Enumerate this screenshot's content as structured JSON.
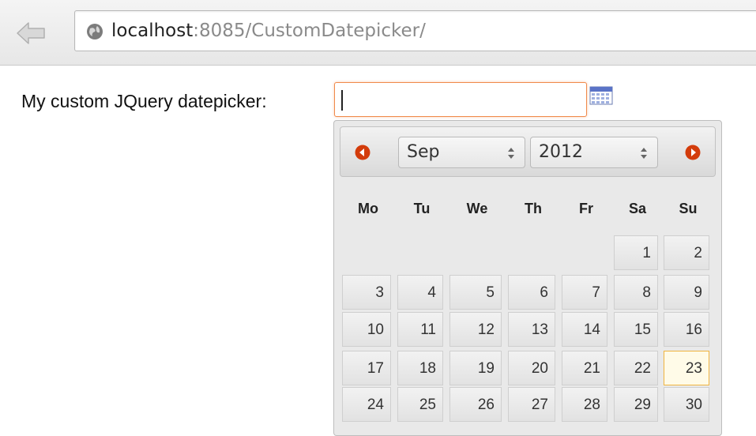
{
  "browser": {
    "url_host": "localhost",
    "url_rest": ":8085/CustomDatepicker/"
  },
  "form": {
    "label": "My custom JQuery datepicker:",
    "input_value": ""
  },
  "datepicker": {
    "month": "Sep",
    "year": "2012",
    "weekdays": [
      "Mo",
      "Tu",
      "We",
      "Th",
      "Fr",
      "Sa",
      "Su"
    ],
    "weeks": [
      [
        "",
        "",
        "",
        "",
        "",
        "1",
        "2"
      ],
      [
        "3",
        "4",
        "5",
        "6",
        "7",
        "8",
        "9"
      ],
      [
        "10",
        "11",
        "12",
        "13",
        "14",
        "15",
        "16"
      ],
      [
        "17",
        "18",
        "19",
        "20",
        "21",
        "22",
        "23"
      ],
      [
        "24",
        "25",
        "26",
        "27",
        "28",
        "29",
        "30"
      ]
    ],
    "highlighted_day": "23"
  },
  "colors": {
    "nav_arrow": "#d33c0b",
    "input_focus_border": "#f08a4b",
    "today_border": "#f0b440"
  },
  "icons": {
    "back": "back-arrow-icon",
    "site": "globe-icon",
    "calendar_trigger": "calendar-icon",
    "prev": "prev-month-icon",
    "next": "next-month-icon"
  }
}
